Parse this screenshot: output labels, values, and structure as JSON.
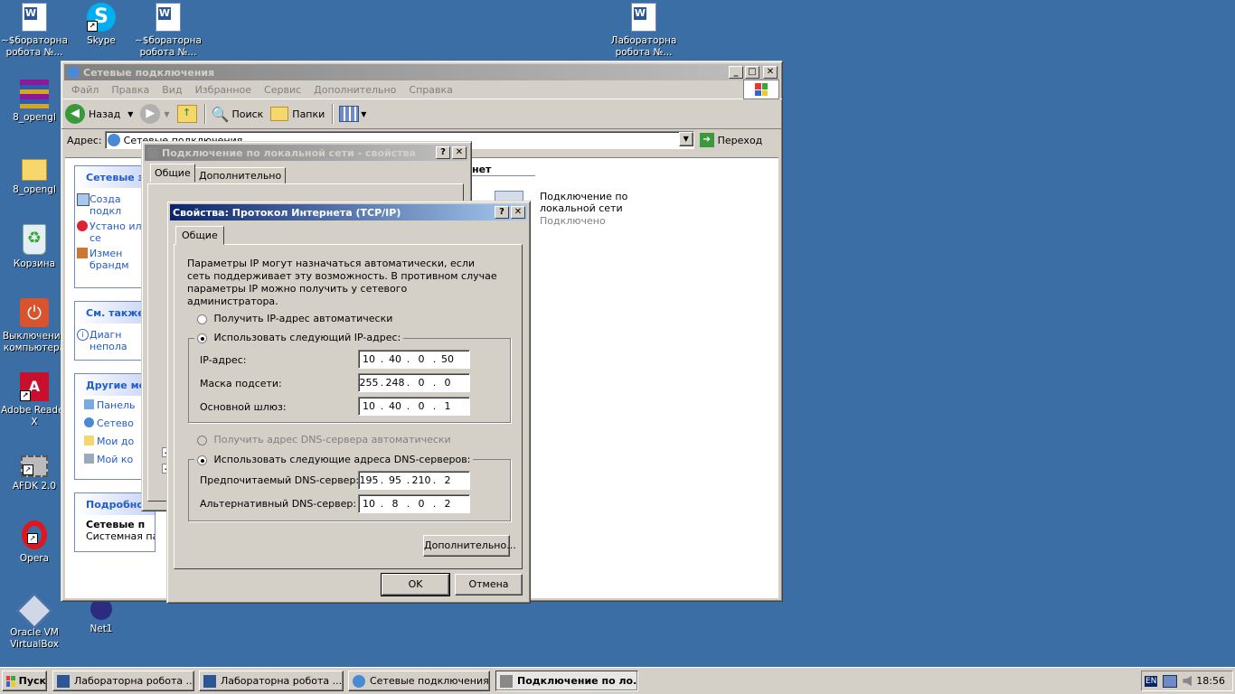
{
  "desktop_icons": [
    {
      "label": "~$бораторна робота №...",
      "icon": "word-document-icon"
    },
    {
      "label": "Skype",
      "icon": "skype-icon"
    },
    {
      "label": "~$бораторна робота №...",
      "icon": "word-document-icon"
    },
    {
      "label": "Лабораторна робота №...",
      "icon": "word-document-icon"
    },
    {
      "label": "8_opengl",
      "icon": "winrar-archive-icon"
    },
    {
      "label": "8_opengl",
      "icon": "folder-icon"
    },
    {
      "label": "Корзина",
      "icon": "recycle-bin-icon"
    },
    {
      "label": "Выключение компьютера",
      "icon": "shutdown-icon"
    },
    {
      "label": "Adobe Reader X",
      "icon": "adobe-reader-icon"
    },
    {
      "label": "AFDK 2.0",
      "icon": "chip-icon"
    },
    {
      "label": "Opera",
      "icon": "opera-icon"
    },
    {
      "label": "Oracle VM VirtualBox",
      "icon": "virtualbox-icon"
    },
    {
      "label": "Net1",
      "icon": "net-icon"
    }
  ],
  "explorer": {
    "title": "Сетевые подключения",
    "menu": [
      "Файл",
      "Правка",
      "Вид",
      "Избранное",
      "Сервис",
      "Дополнительно",
      "Справка"
    ],
    "toolbar": {
      "back": "Назад",
      "search": "Поиск",
      "folders": "Папки"
    },
    "address_label": "Адрес:",
    "address_value": "Сетевые подключения",
    "go_label": "Переход",
    "group_header": "нет",
    "connection": {
      "name": "Подключение по локальной сети",
      "status": "Подключено"
    },
    "side_panels": [
      {
        "title": "Сетевые з",
        "items": [
          "Созда подкл",
          "Устано или се",
          "Измен брандм"
        ]
      },
      {
        "title": "См. также",
        "items": [
          "Диагн непола"
        ]
      },
      {
        "title": "Другие ме",
        "items": [
          "Панель",
          "Сетево",
          "Мои до",
          "Мой ко"
        ]
      },
      {
        "title": "Подробно",
        "items": [
          "Сетевые п",
          "Системная папка"
        ]
      }
    ]
  },
  "lan_dialog": {
    "title": "Подключение по локальной сети - свойства",
    "tabs": [
      "Общие",
      "Дополнительно"
    ]
  },
  "tcpip_dialog": {
    "title": "Свойства: Протокол Интернета (TCP/IP)",
    "tab": "Общие",
    "description": "Параметры IP могут назначаться автоматически, если сеть поддерживает эту возможность. В противном случае параметры IP можно получить у сетевого администратора.",
    "radio_auto_ip": "Получить IP-адрес автоматически",
    "radio_manual_ip": "Использовать следующий IP-адрес:",
    "ip_label": "IP-адрес:",
    "ip": [
      "10",
      "40",
      "0",
      "50"
    ],
    "mask_label": "Маска подсети:",
    "mask": [
      "255",
      "248",
      "0",
      "0"
    ],
    "gateway_label": "Основной шлюз:",
    "gateway": [
      "10",
      "40",
      "0",
      "1"
    ],
    "radio_auto_dns": "Получить адрес DNS-сервера автоматически",
    "radio_manual_dns": "Использовать следующие адреса DNS-серверов:",
    "dns1_label": "Предпочитаемый DNS-сервер:",
    "dns1": [
      "195",
      "95",
      "210",
      "2"
    ],
    "dns2_label": "Альтернативный DNS-сервер:",
    "dns2": [
      "10",
      "8",
      "0",
      "2"
    ],
    "advanced_button": "Дополнительно...",
    "ok_button": "OK",
    "cancel_button": "Отмена"
  },
  "taskbar": {
    "start": "Пуск",
    "tasks": [
      "Лабораторна робота ...",
      "Лабораторна робота ...",
      "Сетевые подключения",
      "Подключение по ло..."
    ],
    "lang": "EN",
    "clock": "18:56"
  }
}
